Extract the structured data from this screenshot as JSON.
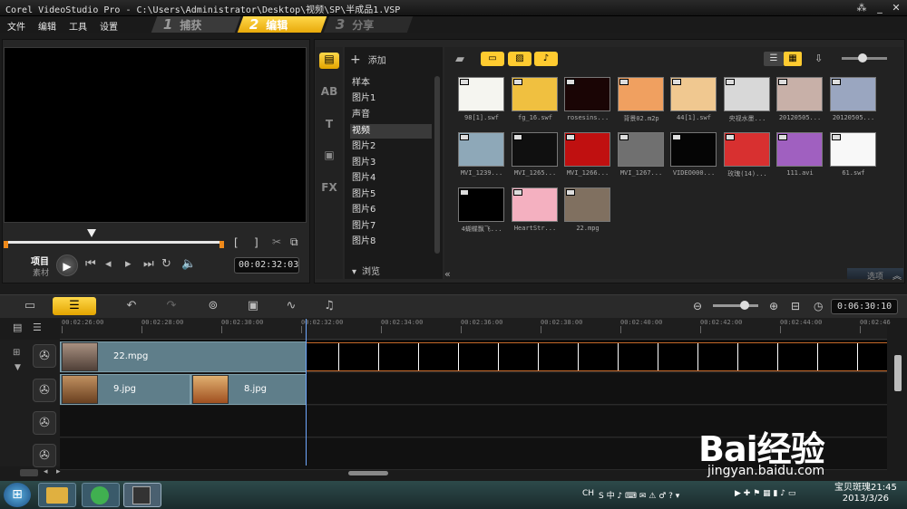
{
  "window": {
    "title": "Corel VideoStudio Pro - C:\\Users\\Administrator\\Desktop\\视频\\SP\\半成品1.VSP"
  },
  "menu": [
    "文件",
    "编辑",
    "工具",
    "设置"
  ],
  "steps": [
    {
      "num": "1",
      "label": "捕获"
    },
    {
      "num": "2",
      "label": "编辑"
    },
    {
      "num": "3",
      "label": "分享"
    }
  ],
  "preview": {
    "mode_project": "项目",
    "mode_clip": "素材",
    "timecode": "00:02:32:03"
  },
  "library": {
    "add_label": "添加",
    "folders": [
      "样本",
      "图片1",
      "声音",
      "视频",
      "图片2",
      "图片3",
      "图片4",
      "图片5",
      "图片6",
      "图片7",
      "图片8"
    ],
    "active_folder": "视频",
    "browse_label": "浏览",
    "options_label": "选项",
    "thumbnails": [
      {
        "label": "98[1].swf",
        "color": "#f5f5f0"
      },
      {
        "label": "fg_16.swf",
        "color": "#f0c040"
      },
      {
        "label": "rosesins...",
        "color": "#1a0505"
      },
      {
        "label": "背景02.m2p",
        "color": "#f0a060"
      },
      {
        "label": "44[1].swf",
        "color": "#f0c890"
      },
      {
        "label": "央视水墨...",
        "color": "#d8d8d8"
      },
      {
        "label": "20120505...",
        "color": "#c8b0a8"
      },
      {
        "label": "20120505...",
        "color": "#9aa6c0"
      },
      {
        "label": "MVI_1239...",
        "color": "#8ea8b8"
      },
      {
        "label": "MVI_1265...",
        "color": "#101010"
      },
      {
        "label": "MVI_1266...",
        "color": "#c01010"
      },
      {
        "label": "MVI_1267...",
        "color": "#707070"
      },
      {
        "label": "VIDEO000...",
        "color": "#050505"
      },
      {
        "label": "玫瑰(14)...",
        "color": "#d83030"
      },
      {
        "label": "111.avi",
        "color": "#a060c0"
      },
      {
        "label": "61.swf",
        "color": "#f8f8f8"
      },
      {
        "label": "4蝴蝶飘飞...",
        "color": "#000000"
      },
      {
        "label": "HeartStr...",
        "color": "#f4b0c0"
      },
      {
        "label": "22.mpg",
        "color": "#807060"
      }
    ]
  },
  "timeline": {
    "duration": "0:06:30:10",
    "ticks": [
      "00:02:26:00",
      "00:02:28:00",
      "00:02:30:00",
      "00:02:32:00",
      "00:02:34:00",
      "00:02:36:00",
      "00:02:38:00",
      "00:02:40:00",
      "00:02:42:00",
      "00:02:44:00",
      "00:02:46"
    ],
    "video_clip": "22.mpg",
    "overlay_clips": [
      "9.jpg",
      "8.jpg"
    ]
  },
  "taskbar": {
    "tray_lang": "CH",
    "user": "宝贝斑瑰",
    "time": "21:45",
    "date": "2013/3/26"
  },
  "watermark": {
    "brand": "Bai经验",
    "url": "jingyan.baidu.com"
  }
}
